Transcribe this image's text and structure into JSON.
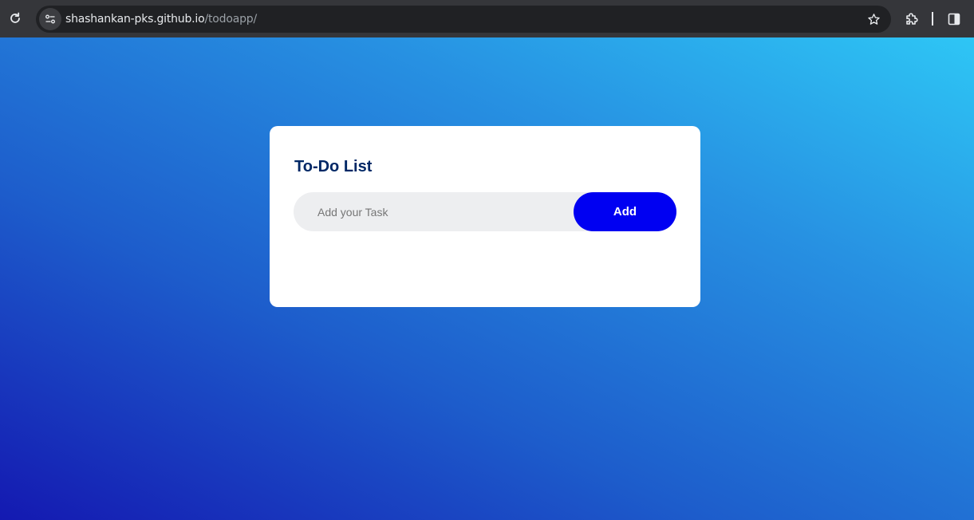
{
  "browser": {
    "url_host": "shashankan-pks.github.io",
    "url_path": "/todoapp/",
    "icons": {
      "reload": "reload-icon",
      "site_info": "site-settings-icon",
      "bookmark": "star-icon",
      "extensions": "puzzle-icon",
      "side_panel": "side-panel-icon"
    }
  },
  "todo": {
    "title": "To-Do List",
    "input_placeholder": "Add your Task",
    "input_value": "",
    "add_label": "Add"
  },
  "colors": {
    "add_button": "#0000f2",
    "title": "#002765",
    "input_bg": "#edeef0",
    "gradient_start": "#2ec6f5",
    "gradient_end": "#1419b1"
  }
}
